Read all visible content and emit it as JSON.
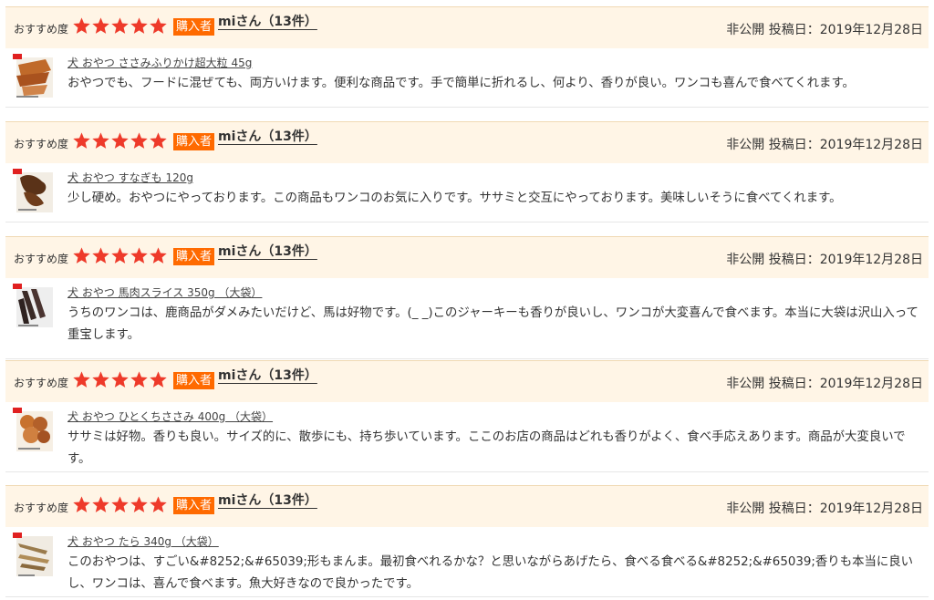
{
  "colors": {
    "header_bg": "#fff5e6",
    "badge": "#ff6a00",
    "star": "#ee3a2a"
  },
  "reviews": [
    {
      "rec_label": "おすすめ度",
      "stars": 5,
      "badge": "購入者",
      "reviewer": "miさん（13件）",
      "meta": "非公開 投稿日：2019年12月28日",
      "product": "犬 おやつ ささみふりかけ超大粒 45g",
      "thumb_icon": "product-thumbnail-icon",
      "text": "おやつでも、フードに混ぜても、両方いけます。便利な商品です。手で簡単に折れるし、何より、香りが良い。ワンコも喜んで食べてくれます。"
    },
    {
      "rec_label": "おすすめ度",
      "stars": 5,
      "badge": "購入者",
      "reviewer": "miさん（13件）",
      "meta": "非公開 投稿日：2019年12月28日",
      "product": "犬 おやつ すなぎも 120g",
      "thumb_icon": "product-thumbnail-icon",
      "text": "少し硬め。おやつにやっております。この商品もワンコのお気に入りです。ササミと交互にやっております。美味しいそうに食べてくれます。"
    },
    {
      "rec_label": "おすすめ度",
      "stars": 5,
      "badge": "購入者",
      "reviewer": "miさん（13件）",
      "meta": "非公開 投稿日：2019年12月28日",
      "product": "犬 おやつ 馬肉スライス 350g （大袋）",
      "thumb_icon": "product-thumbnail-icon",
      "text": "うちのワンコは、鹿商品がダメみたいだけど、馬は好物です。(_ _)このジャーキーも香りが良いし、ワンコが大変喜んで食べます。本当に大袋は沢山入って重宝します。"
    },
    {
      "rec_label": "おすすめ度",
      "stars": 5,
      "badge": "購入者",
      "reviewer": "miさん（13件）",
      "meta": "非公開 投稿日：2019年12月28日",
      "product": "犬 おやつ ひとくちささみ 400g （大袋）",
      "thumb_icon": "product-thumbnail-icon",
      "text": "ササミは好物。香りも良い。サイズ的に、散歩にも、持ち歩いています。ここのお店の商品はどれも香りがよく、食べ手応えあります。商品が大変良いです。"
    },
    {
      "rec_label": "おすすめ度",
      "stars": 5,
      "badge": "購入者",
      "reviewer": "miさん（13件）",
      "meta": "非公開 投稿日：2019年12月28日",
      "product": "犬 おやつ たら 340g （大袋）",
      "thumb_icon": "product-thumbnail-icon",
      "text": "このおやつは、すごい&#8252;&#65039;形もまんま。最初食べれるかな？と思いながらあげたら、食べる食べる&#8252;&#65039;香りも本当に良いし、ワンコは、喜んで食べます。魚大好きなので良かったです。"
    }
  ]
}
